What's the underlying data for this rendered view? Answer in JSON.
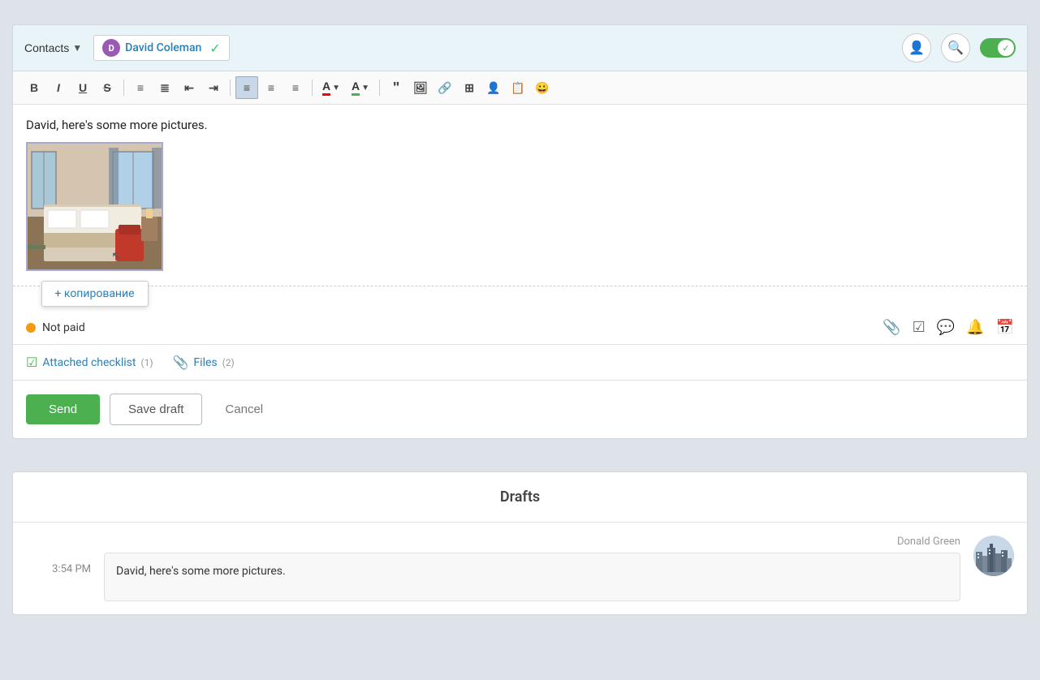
{
  "header": {
    "contacts_label": "Contacts",
    "recipient_initial": "D",
    "recipient_name": "David Coleman",
    "toggle_active": true
  },
  "toolbar": {
    "bold": "B",
    "italic": "I",
    "underline": "U",
    "strikethrough": "S",
    "ordered_list": "OL",
    "unordered_list": "UL",
    "indent_left": "←",
    "indent_right": "→",
    "align_left": "≡",
    "align_center": "≡",
    "align_right": "≡",
    "font_color": "A",
    "font_bg": "A",
    "blockquote": "\"",
    "image": "🖼",
    "link": "🔗",
    "table": "⊞",
    "person": "👤",
    "template": "📋",
    "emoji": "😀"
  },
  "compose": {
    "body_text": "David, here's some more pictures.",
    "copy_tooltip": "+ копирование"
  },
  "status": {
    "dot_color": "#f39c12",
    "text": "Not paid"
  },
  "attachments": {
    "checklist_label": "Attached checklist",
    "checklist_count": "(1)",
    "files_label": "Files",
    "files_count": "(2)"
  },
  "actions": {
    "send_label": "Send",
    "save_draft_label": "Save draft",
    "cancel_label": "Cancel"
  },
  "drafts": {
    "header": "Drafts",
    "items": [
      {
        "time": "3:54 PM",
        "author": "Donald Green",
        "text": "David, here's some more pictures."
      }
    ]
  }
}
